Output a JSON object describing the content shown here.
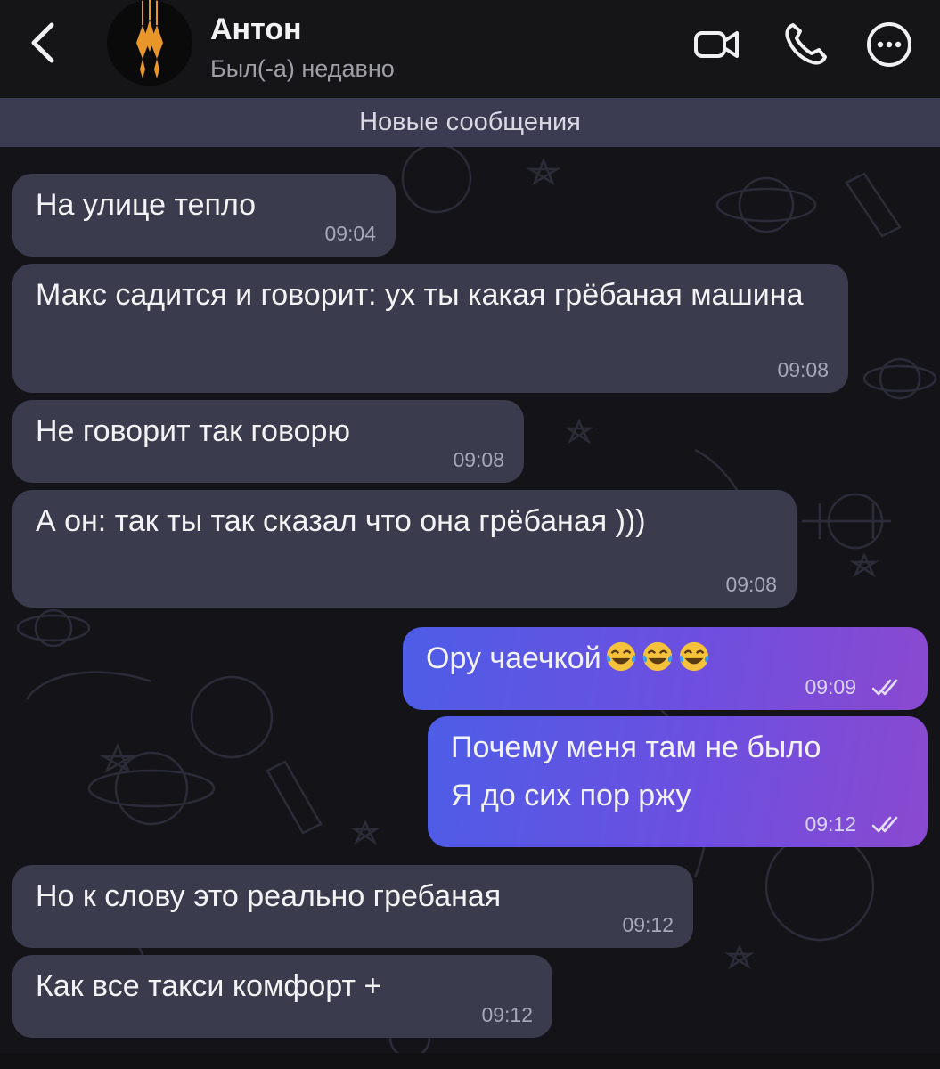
{
  "header": {
    "back_label": "‹",
    "contact_name": "Антон",
    "status": "Был(-а) недавно",
    "icons": [
      "back-arrow-icon",
      "video-call-icon",
      "phone-icon",
      "more-options-icon"
    ],
    "accent_color": "#e8962a"
  },
  "banner": {
    "label": "Новые сообщения"
  },
  "messages": [
    {
      "direction": "in",
      "text": "На улице тепло",
      "time": "09:04"
    },
    {
      "direction": "in",
      "text": "Макс садится и говорит: ух ты какая грёбаная машина",
      "time": "09:08"
    },
    {
      "direction": "in",
      "text": "Не говорит так говорю",
      "time": "09:08"
    },
    {
      "direction": "in",
      "text": "А он: так ты так сказал что она грёбаная )))",
      "time": "09:08"
    },
    {
      "direction": "out",
      "text": "Ору чаечкой",
      "emoji": "😂😂😂",
      "time": "09:09",
      "read": true
    },
    {
      "direction": "out",
      "text": "Почему меня там не было\nЯ до сих пор ржу",
      "time": "09:12",
      "read": true
    },
    {
      "direction": "in",
      "text": "Но к слову это реально гребаная",
      "time": "09:12"
    },
    {
      "direction": "in",
      "text": "Как все такси комфорт +",
      "time": "09:12"
    }
  ],
  "colors": {
    "incoming_bubble": "#3a3b4c",
    "outgoing_gradient": [
      "#4d5de6",
      "#8a49cf"
    ],
    "background": "#141418"
  }
}
